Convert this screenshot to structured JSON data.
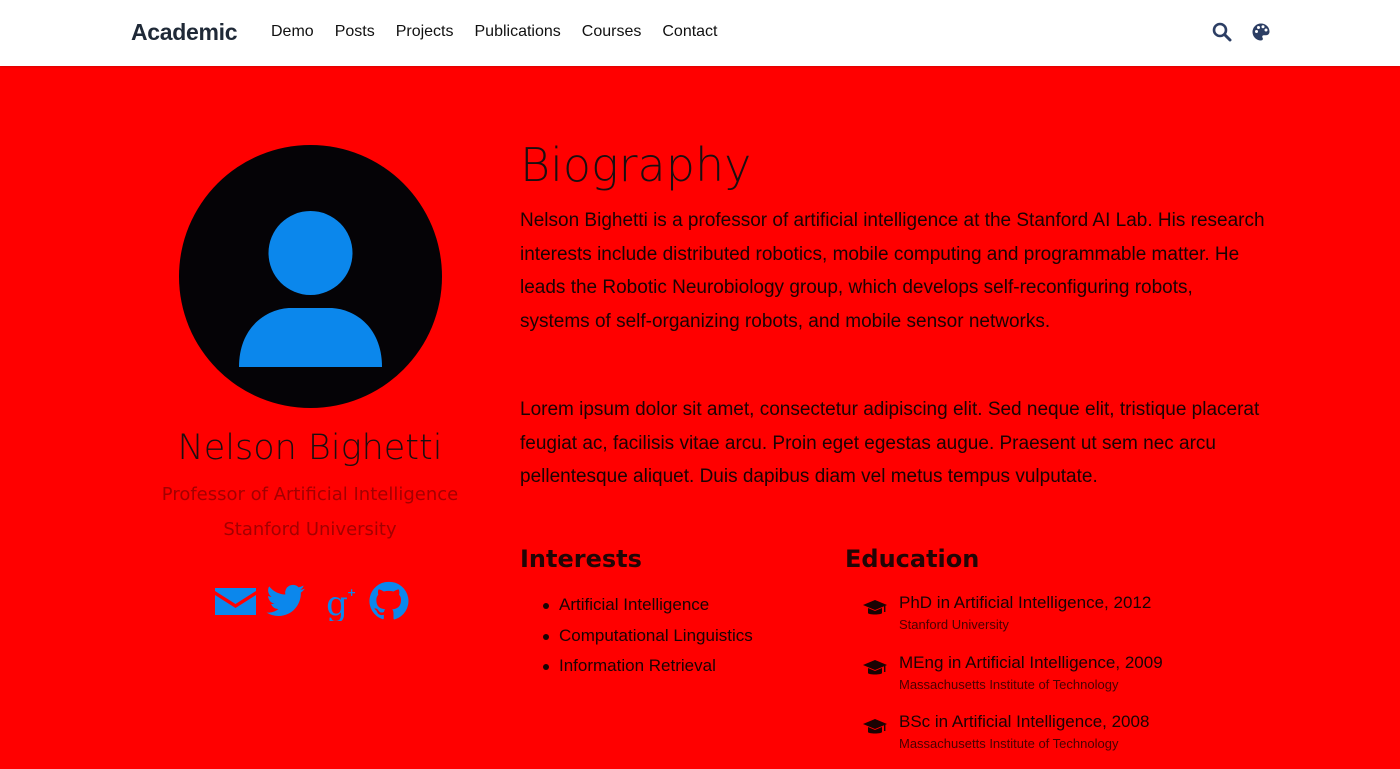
{
  "colors": {
    "background": "#ff0000",
    "accent": "#0b87ec",
    "avatar_bg": "#050306"
  },
  "navbar": {
    "brand": "Academic",
    "links": [
      "Demo",
      "Posts",
      "Projects",
      "Publications",
      "Courses",
      "Contact"
    ],
    "icons": [
      "search-icon",
      "palette-icon"
    ]
  },
  "profile": {
    "name": "Nelson Bighetti",
    "role": "Professor of Artificial Intelligence",
    "organization": "Stanford University",
    "social_icons": [
      "envelope-icon",
      "twitter-icon",
      "google-scholar-icon",
      "github-icon"
    ]
  },
  "biography": {
    "title": "Biography",
    "paragraphs": [
      "Nelson Bighetti is a professor of artificial intelligence at the Stanford AI Lab. His research interests include distributed robotics, mobile computing and programmable matter. He leads the Robotic Neurobiology group, which develops self-reconfiguring robots, systems of self-organizing robots, and mobile sensor networks.",
      "Lorem ipsum dolor sit amet, consectetur adipiscing elit. Sed neque elit, tristique placerat feugiat ac, facilisis vitae arcu. Proin eget egestas augue. Praesent ut sem nec arcu pellentesque aliquet. Duis dapibus diam vel metus tempus vulputate."
    ]
  },
  "interests": {
    "title": "Interests",
    "items": [
      "Artificial Intelligence",
      "Computational Linguistics",
      "Information Retrieval"
    ]
  },
  "education": {
    "title": "Education",
    "items": [
      {
        "course": "PhD in Artificial Intelligence, 2012",
        "institution": "Stanford University"
      },
      {
        "course": "MEng in Artificial Intelligence, 2009",
        "institution": "Massachusetts Institute of Technology"
      },
      {
        "course": "BSc in Artificial Intelligence, 2008",
        "institution": "Massachusetts Institute of Technology"
      }
    ]
  }
}
